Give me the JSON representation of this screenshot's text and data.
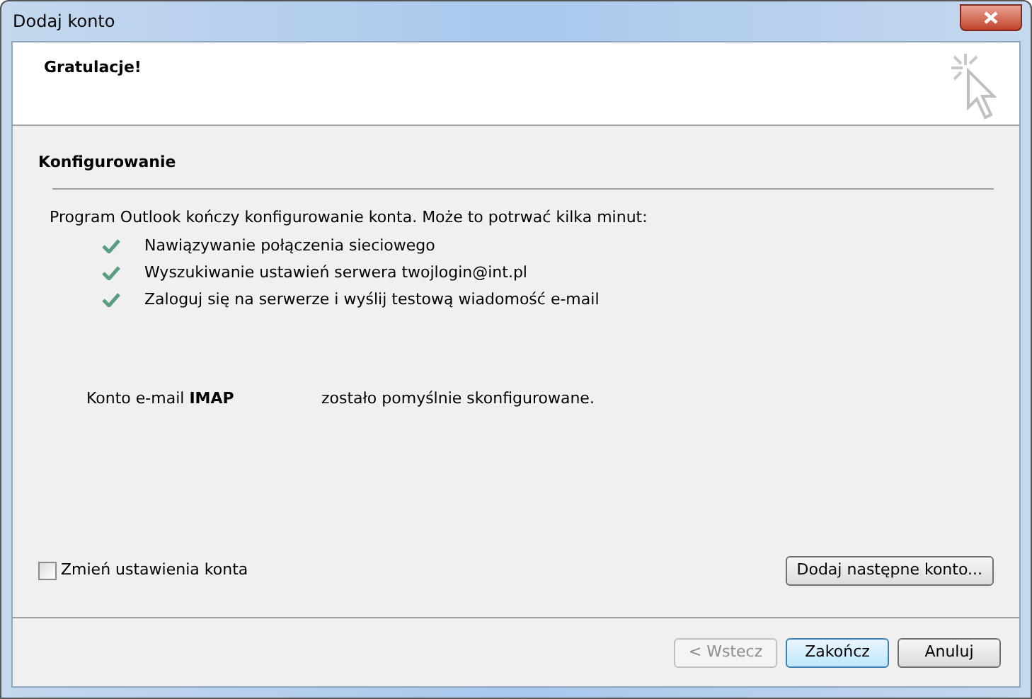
{
  "window": {
    "title": "Dodaj konto"
  },
  "header": {
    "title": "Gratulacje!"
  },
  "section": {
    "title": "Konfigurowanie"
  },
  "intro": "Program Outlook kończy konfigurowanie konta. Może to potrwać kilka minut:",
  "steps": [
    {
      "label": "Nawiązywanie połączenia sieciowego",
      "done": true
    },
    {
      "label": "Wyszukiwanie ustawień serwera twojlogin@int.pl",
      "done": true
    },
    {
      "label": "Zaloguj się na serwerze i wyślij testową wiadomość e-mail",
      "done": true
    }
  ],
  "result": {
    "account": "Konto e-mail **IMAP**",
    "message": "zostało pomyślnie skonfigurowane."
  },
  "change_settings": {
    "label": "Zmień ustawienia konta",
    "checked": false
  },
  "add_another": "Dodaj następne konto...",
  "buttons": [
    {
      "label": "< Wstecz",
      "disabled": true,
      "default": false
    },
    {
      "label": "Zakończ",
      "disabled": false,
      "default": true
    },
    {
      "label": "Anuluj",
      "disabled": false,
      "default": false
    }
  ]
}
